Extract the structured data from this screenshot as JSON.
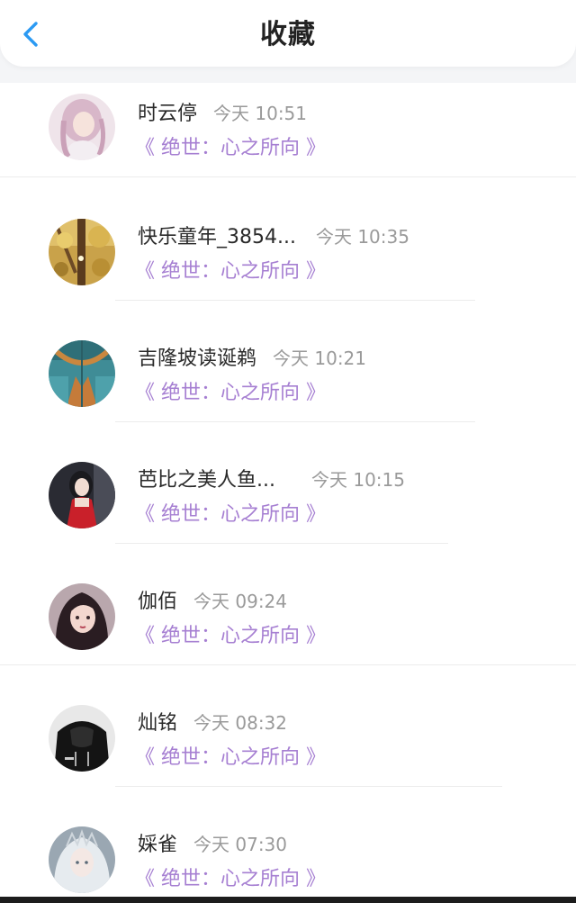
{
  "header": {
    "title": "收藏",
    "back_icon": "chevron-left-icon",
    "accent_color": "#2b9af3"
  },
  "items": [
    {
      "name": "时云停",
      "time": "今天 10:51",
      "book": "《 绝世：心之所向 》",
      "avatar": "avatar-girl-pink-hair"
    },
    {
      "name": "快乐童年_3854...",
      "time": "今天 10:35",
      "book": "《 绝世：心之所向 》",
      "avatar": "avatar-autumn-tree"
    },
    {
      "name": "吉隆坡读诞鹈",
      "time": "今天 10:21",
      "book": "《 绝世：心之所向 》",
      "avatar": "avatar-denim"
    },
    {
      "name": "芭比之美人鱼...",
      "time": "今天 10:15",
      "book": "《 绝世：心之所向 》",
      "avatar": "avatar-girl-red-dress"
    },
    {
      "name": "伽佰",
      "time": "今天 09:24",
      "book": "《 绝世：心之所向 》",
      "avatar": "avatar-anime-girl"
    },
    {
      "name": "灿铭",
      "time": "今天 08:32",
      "book": "《 绝世：心之所向 》",
      "avatar": "avatar-black-hoodie"
    },
    {
      "name": "婇雀",
      "time": "今天 07:30",
      "book": "《 绝世：心之所向 》",
      "avatar": "avatar-anime-white-hair"
    }
  ],
  "colors": {
    "book_title": "#a67fd2",
    "time": "#9a9a9a",
    "name": "#2a2a2a"
  }
}
